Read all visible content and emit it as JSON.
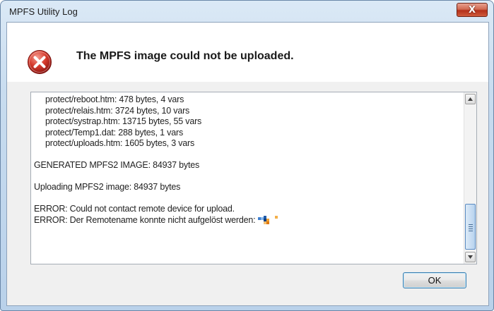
{
  "window": {
    "title": "MPFS Utility Log",
    "close_label": "X"
  },
  "header": {
    "message": "The MPFS image could not be uploaded."
  },
  "log": {
    "lines": [
      "protect/reboot.htm: 478 bytes, 4 vars",
      "protect/relais.htm: 3724 bytes, 10 vars",
      "protect/systrap.htm: 13715 bytes, 55 vars",
      "protect/Temp1.dat: 288 bytes, 1 vars",
      "protect/uploads.htm: 1605 bytes, 3 vars",
      "",
      "GENERATED MPFS2 IMAGE: 84937 bytes",
      "",
      "Uploading MPFS2 image: 84937 bytes",
      "",
      "ERROR: Could not contact remote device for upload.",
      "ERROR: Der Remotename konnte nicht aufgelöst werden:"
    ]
  },
  "scrollbar": {
    "up_icon": "scroll-up-arrow-icon",
    "down_icon": "scroll-down-arrow-icon",
    "position": 0.85
  },
  "buttons": {
    "ok_label": "OK"
  },
  "colors": {
    "error_red": "#c8201c",
    "accent_blue": "#3c7fb1"
  }
}
